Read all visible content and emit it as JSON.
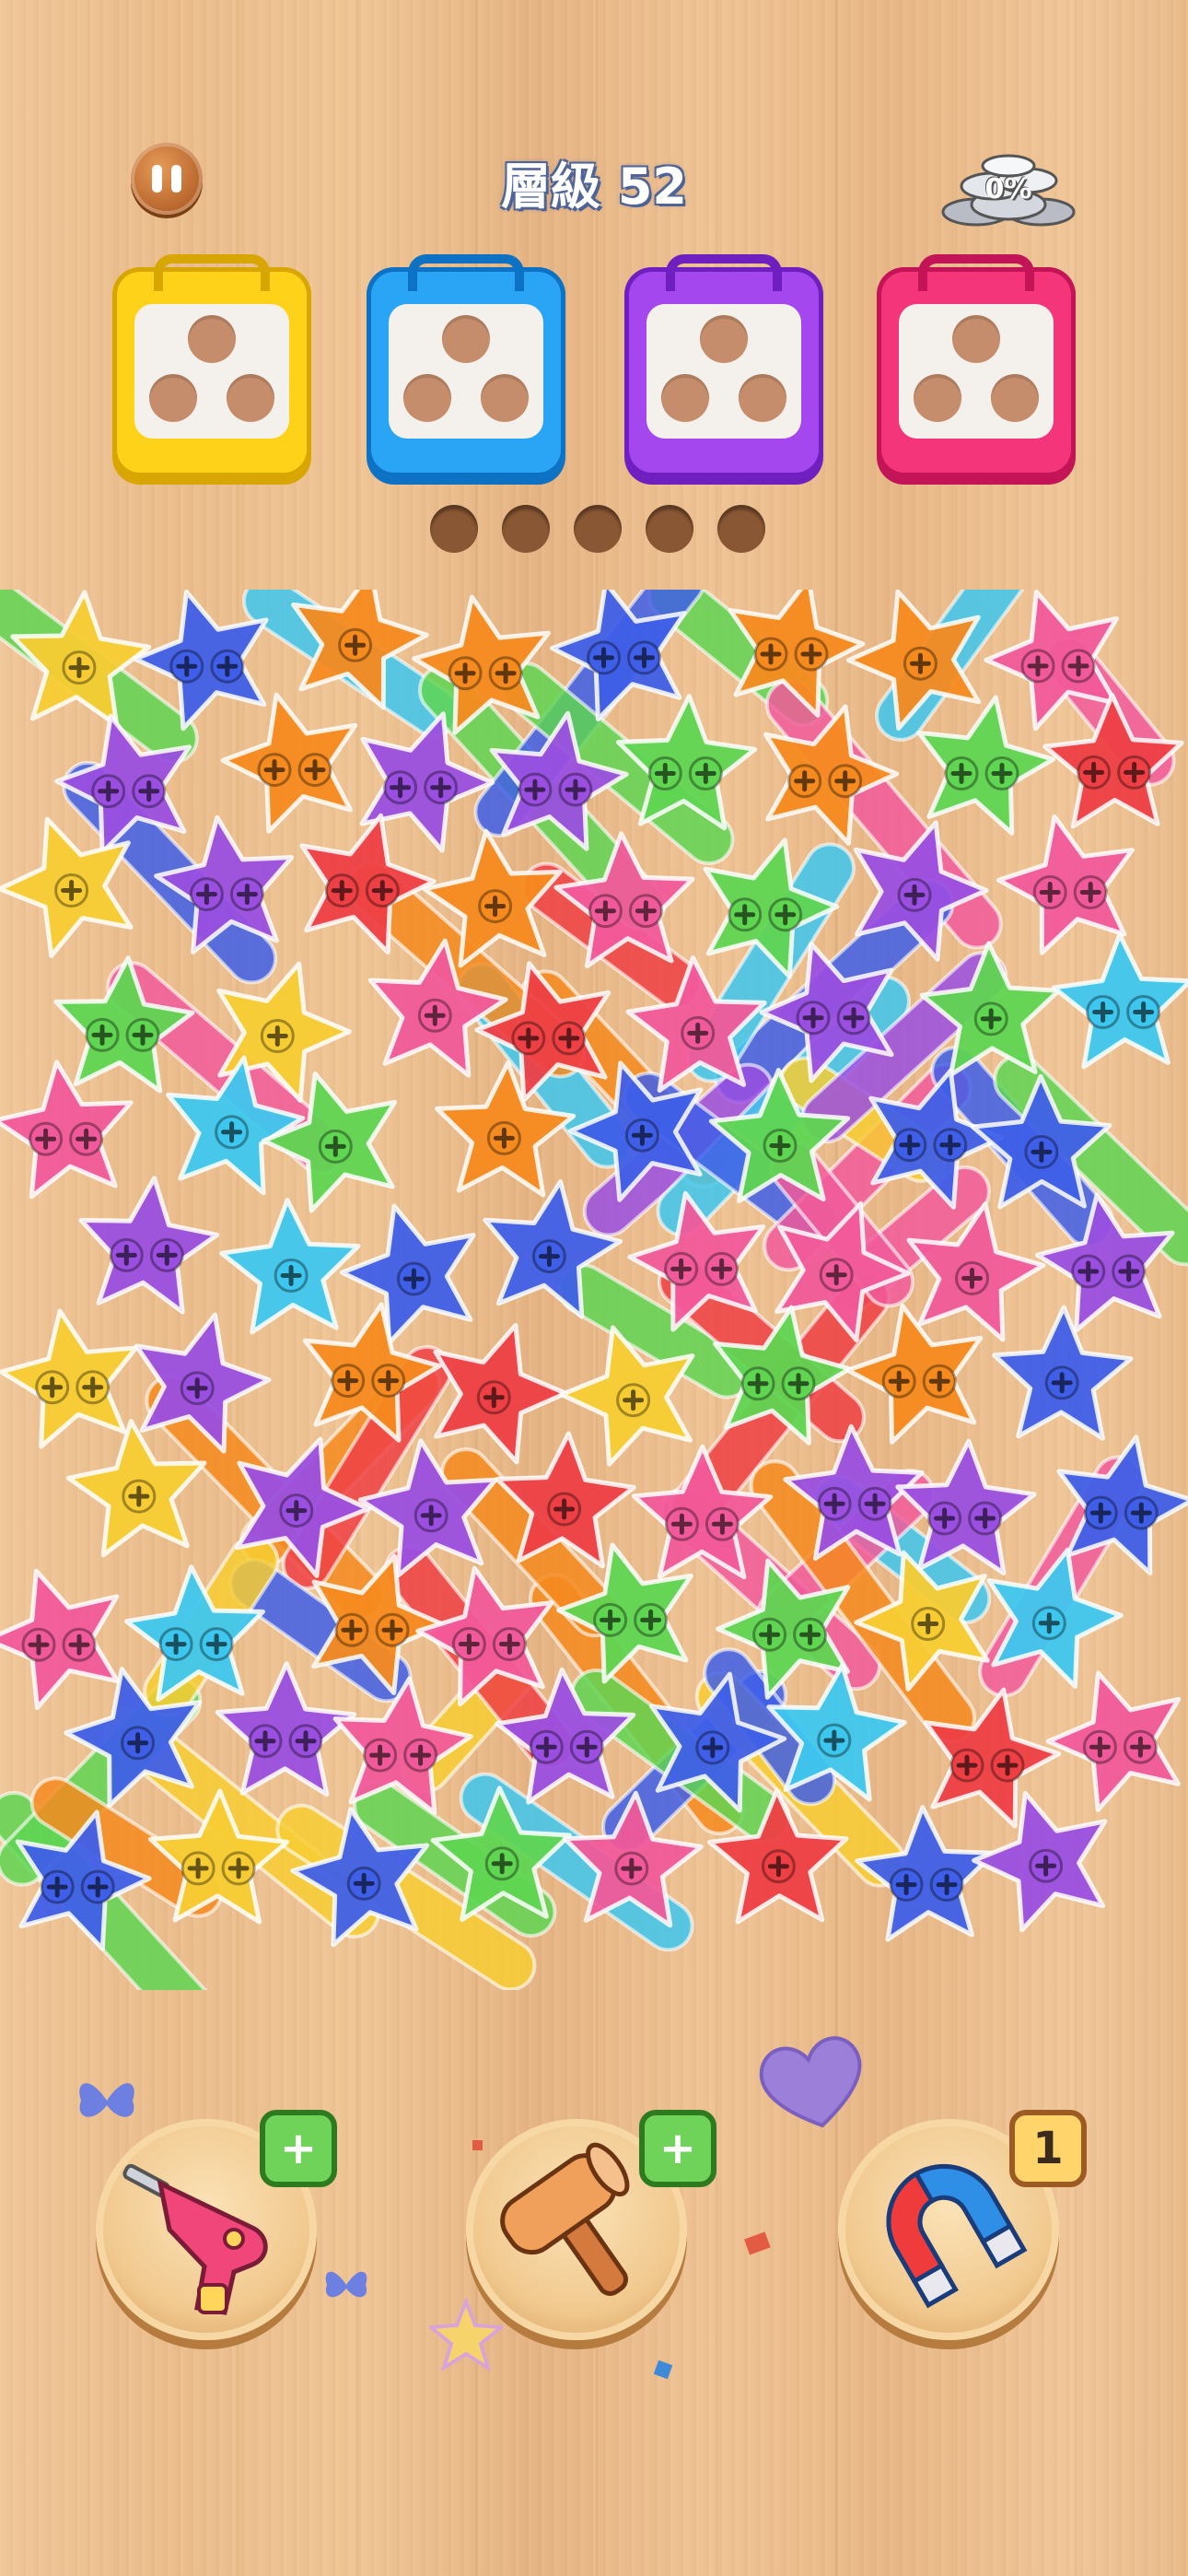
{
  "header": {
    "level_label": "層級 52",
    "coin_percent": "0%"
  },
  "pause_icon": "pause-icon",
  "boxes": [
    {
      "color": "#ffd21a",
      "dark": "#d8a600",
      "holes": 3
    },
    {
      "color": "#2aa4f4",
      "dark": "#0d72c4",
      "holes": 3
    },
    {
      "color": "#a447ee",
      "dark": "#6f1fc0",
      "holes": 3
    },
    {
      "color": "#f5357a",
      "dark": "#c21456",
      "holes": 3
    }
  ],
  "buffer_slots": 5,
  "palette": {
    "red": "#ee3f44",
    "orange": "#f58a1f",
    "yellow": "#f7cc33",
    "green": "#5fd552",
    "cyan": "#3ec7ee",
    "blue": "#3f5fe8",
    "purple": "#9a4fe0",
    "pink": "#f15a9a"
  },
  "tools": [
    {
      "name": "drill",
      "badge": "+",
      "badge_type": "plus"
    },
    {
      "name": "hammer",
      "badge": "+",
      "badge_type": "plus"
    },
    {
      "name": "magnet",
      "badge": "1",
      "badge_type": "num"
    }
  ]
}
